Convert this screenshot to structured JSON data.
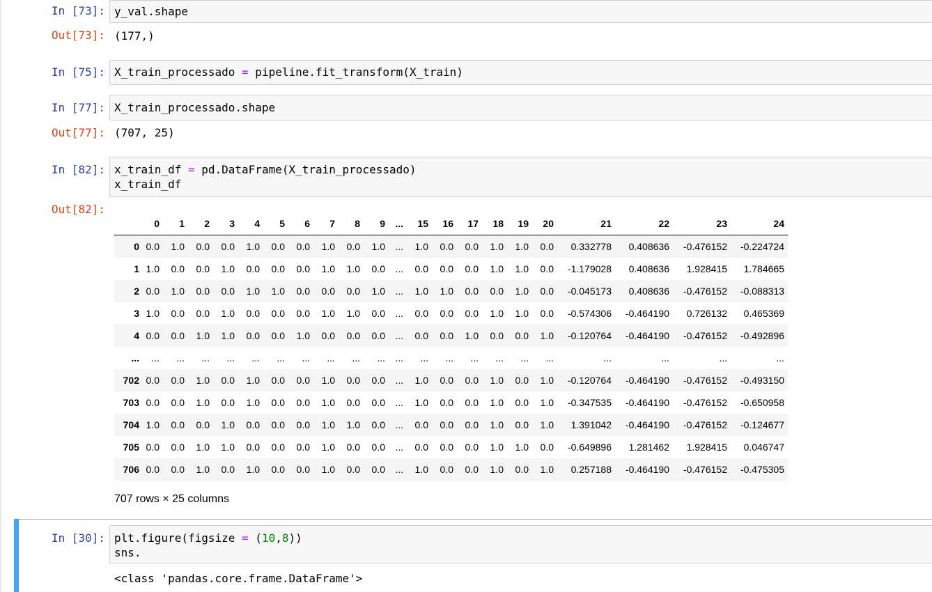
{
  "cells": [
    {
      "in_prompt": "In [73]:",
      "code_lines": [
        "y_val.shape"
      ],
      "out_prompt": "Out[73]:",
      "output": "(177,)"
    },
    {
      "in_prompt": "In [75]:",
      "code_a": "X_train_processado ",
      "code_op": "=",
      "code_b": " pipeline.fit_transform(X_train)"
    },
    {
      "in_prompt": "In [77]:",
      "code_lines": [
        "X_train_processado.shape"
      ],
      "out_prompt": "Out[77]:",
      "output": "(707, 25)"
    },
    {
      "in_prompt": "In [82]:",
      "code_a": "x_train_df ",
      "code_op": "=",
      "code_b": " pd.DataFrame(X_train_processado)",
      "code_line2": "x_train_df",
      "out_prompt": "Out[82]:"
    },
    {
      "in_prompt": "In [30]:",
      "code_a": "plt.figure(figsize ",
      "code_op": "=",
      "code_b": " (",
      "num1": "10",
      "comma": ",",
      "num2": "8",
      "code_c": "))",
      "code_line2": "sns.",
      "output": "<class 'pandas.core.frame.DataFrame'>"
    }
  ],
  "dataframe": {
    "columns": [
      "0",
      "1",
      "2",
      "3",
      "4",
      "5",
      "6",
      "7",
      "8",
      "9",
      "...",
      "15",
      "16",
      "17",
      "18",
      "19",
      "20",
      "21",
      "22",
      "23",
      "24"
    ],
    "rows": [
      {
        "index": "0",
        "cells": [
          "0.0",
          "1.0",
          "0.0",
          "0.0",
          "1.0",
          "0.0",
          "0.0",
          "1.0",
          "0.0",
          "1.0",
          "...",
          "1.0",
          "0.0",
          "0.0",
          "1.0",
          "1.0",
          "0.0",
          "0.332778",
          "0.408636",
          "-0.476152",
          "-0.224724"
        ]
      },
      {
        "index": "1",
        "cells": [
          "1.0",
          "0.0",
          "0.0",
          "1.0",
          "0.0",
          "0.0",
          "0.0",
          "1.0",
          "1.0",
          "0.0",
          "...",
          "0.0",
          "0.0",
          "0.0",
          "1.0",
          "1.0",
          "0.0",
          "-1.179028",
          "0.408636",
          "1.928415",
          "1.784665"
        ]
      },
      {
        "index": "2",
        "cells": [
          "0.0",
          "1.0",
          "0.0",
          "0.0",
          "1.0",
          "1.0",
          "0.0",
          "0.0",
          "0.0",
          "1.0",
          "...",
          "1.0",
          "1.0",
          "0.0",
          "0.0",
          "1.0",
          "0.0",
          "-0.045173",
          "0.408636",
          "-0.476152",
          "-0.088313"
        ]
      },
      {
        "index": "3",
        "cells": [
          "1.0",
          "0.0",
          "0.0",
          "1.0",
          "0.0",
          "0.0",
          "0.0",
          "1.0",
          "1.0",
          "0.0",
          "...",
          "0.0",
          "0.0",
          "0.0",
          "1.0",
          "1.0",
          "0.0",
          "-0.574306",
          "-0.464190",
          "0.726132",
          "0.465369"
        ]
      },
      {
        "index": "4",
        "cells": [
          "0.0",
          "0.0",
          "1.0",
          "1.0",
          "0.0",
          "0.0",
          "1.0",
          "0.0",
          "0.0",
          "0.0",
          "...",
          "0.0",
          "0.0",
          "1.0",
          "0.0",
          "0.0",
          "1.0",
          "-0.120764",
          "-0.464190",
          "-0.476152",
          "-0.492896"
        ]
      },
      {
        "index": "...",
        "cells": [
          "...",
          "...",
          "...",
          "...",
          "...",
          "...",
          "...",
          "...",
          "...",
          "...",
          "...",
          "...",
          "...",
          "...",
          "...",
          "...",
          "...",
          "...",
          "...",
          "...",
          "..."
        ]
      },
      {
        "index": "702",
        "cells": [
          "0.0",
          "0.0",
          "1.0",
          "0.0",
          "1.0",
          "0.0",
          "0.0",
          "1.0",
          "0.0",
          "0.0",
          "...",
          "1.0",
          "0.0",
          "0.0",
          "1.0",
          "0.0",
          "1.0",
          "-0.120764",
          "-0.464190",
          "-0.476152",
          "-0.493150"
        ]
      },
      {
        "index": "703",
        "cells": [
          "0.0",
          "0.0",
          "1.0",
          "0.0",
          "1.0",
          "0.0",
          "0.0",
          "1.0",
          "0.0",
          "0.0",
          "...",
          "1.0",
          "0.0",
          "0.0",
          "1.0",
          "0.0",
          "1.0",
          "-0.347535",
          "-0.464190",
          "-0.476152",
          "-0.650958"
        ]
      },
      {
        "index": "704",
        "cells": [
          "1.0",
          "0.0",
          "0.0",
          "1.0",
          "0.0",
          "0.0",
          "0.0",
          "1.0",
          "1.0",
          "0.0",
          "...",
          "0.0",
          "0.0",
          "0.0",
          "1.0",
          "0.0",
          "1.0",
          "1.391042",
          "-0.464190",
          "-0.476152",
          "-0.124677"
        ]
      },
      {
        "index": "705",
        "cells": [
          "0.0",
          "0.0",
          "1.0",
          "1.0",
          "0.0",
          "0.0",
          "0.0",
          "1.0",
          "0.0",
          "0.0",
          "...",
          "0.0",
          "0.0",
          "0.0",
          "1.0",
          "1.0",
          "0.0",
          "-0.649896",
          "1.281462",
          "1.928415",
          "0.046747"
        ]
      },
      {
        "index": "706",
        "cells": [
          "0.0",
          "0.0",
          "1.0",
          "0.0",
          "1.0",
          "0.0",
          "0.0",
          "1.0",
          "0.0",
          "0.0",
          "...",
          "1.0",
          "0.0",
          "0.0",
          "1.0",
          "0.0",
          "1.0",
          "0.257188",
          "-0.464190",
          "-0.476152",
          "-0.475305"
        ]
      }
    ],
    "dimensions": "707 rows × 25 columns"
  },
  "colors": {
    "in_prompt": "#303f9f",
    "out_prompt": "#d84315",
    "operator": "#aa22ff",
    "number_literal": "#008000",
    "selected_cell_bar": "#42a5f5"
  }
}
